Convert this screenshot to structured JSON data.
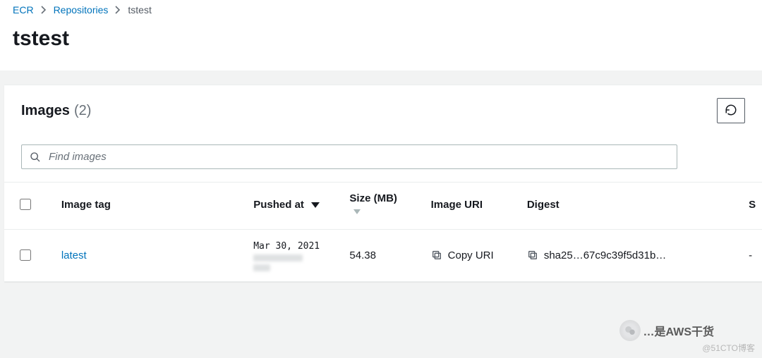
{
  "breadcrumb": {
    "items": [
      {
        "label": "ECR",
        "type": "link"
      },
      {
        "label": "Repositories",
        "type": "link"
      },
      {
        "label": "tstest",
        "type": "current"
      }
    ]
  },
  "page": {
    "title": "tstest"
  },
  "panel": {
    "title": "Images",
    "count_prefix": "(",
    "count": "2",
    "count_suffix": ")",
    "search_placeholder": "Find images"
  },
  "columns": {
    "image_tag": "Image tag",
    "pushed_at": "Pushed at",
    "size": "Size (MB)",
    "image_uri": "Image URI",
    "digest": "Digest",
    "scan_status": "S"
  },
  "rows": [
    {
      "tag": "latest",
      "pushed_at": "Mar 30, 2021",
      "size": "54.38",
      "uri_label": "Copy URI",
      "digest": "sha25…67c9c39f5d31b…",
      "scan": "-"
    }
  ],
  "icons": {
    "refresh": "refresh",
    "search": "search",
    "copy": "copy"
  },
  "watermark": {
    "wechat_text": "…是AWS干货",
    "cto": "@51CTO博客"
  }
}
